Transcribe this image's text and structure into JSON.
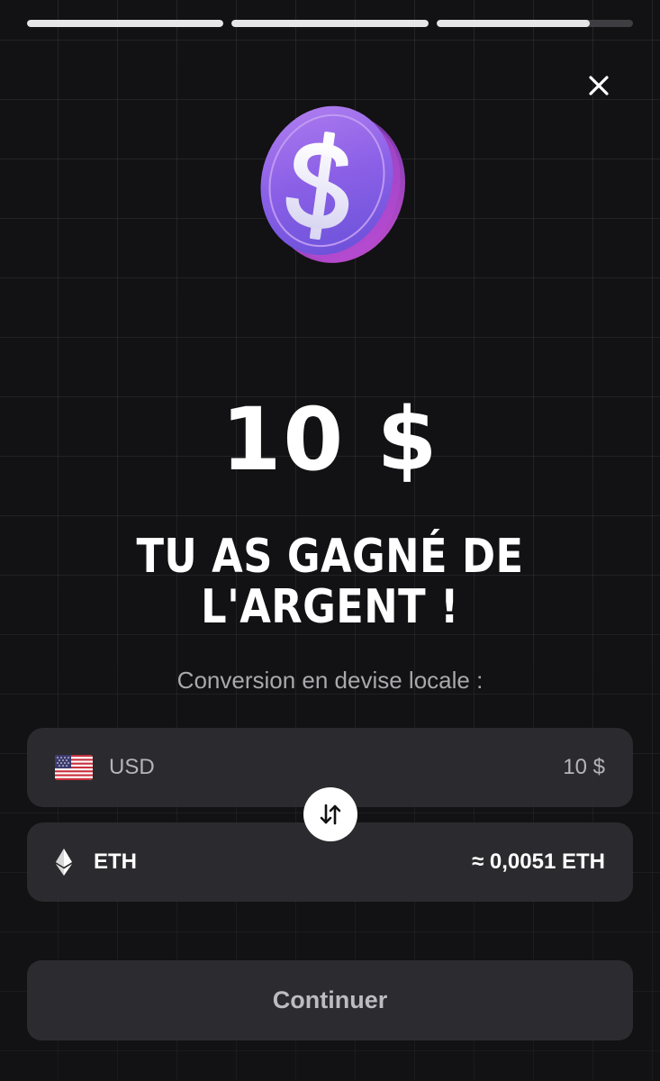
{
  "story_progress": [
    1,
    1,
    0.78
  ],
  "close_icon": "close-icon",
  "reward": {
    "coin_icon": "dollar-coin-icon",
    "amount": "10 $",
    "headline_line1": "TU AS GAGNÉ DE",
    "headline_line2": "L'ARGENT !"
  },
  "conversion": {
    "label": "Conversion en devise locale :",
    "from": {
      "flag_icon": "us-flag-icon",
      "currency": "USD",
      "value": "10 $"
    },
    "swap_icon": "swap-arrows-icon",
    "to": {
      "icon": "ethereum-icon",
      "currency": "ETH",
      "value": "≈ 0,0051 ETH"
    }
  },
  "continue_label": "Continuer",
  "colors": {
    "background": "#121113",
    "coin_purple": "#8b5cf6",
    "coin_pink": "#d946ef",
    "row_background": "#2e2d31",
    "button_background": "#2c2b2f"
  }
}
